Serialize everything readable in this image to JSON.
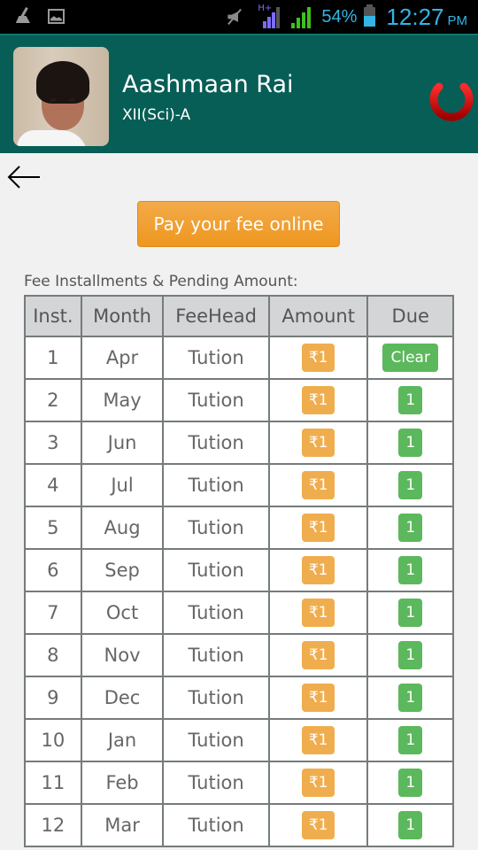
{
  "status_bar": {
    "left_icons": [
      "cleaner-icon",
      "gallery-icon"
    ],
    "right_icons": [
      "mute-icon",
      "signal-hplus-icon",
      "signal-icon",
      "battery-icon"
    ],
    "network_label": "H+",
    "battery_percent": "54%",
    "time": "12:27",
    "ampm": "PM"
  },
  "header": {
    "student_name": "Aashmaan Rai",
    "student_class": "XII(Sci)-A",
    "power_icon": "power-icon"
  },
  "nav": {
    "back_icon": "back-arrow-icon"
  },
  "pay_button": {
    "label": "Pay your fee online"
  },
  "fee_table": {
    "caption": "Fee Installments & Pending Amount:",
    "headers": [
      "Inst.",
      "Month",
      "FeeHead",
      "Amount",
      "Due"
    ],
    "rows": [
      {
        "inst": "1",
        "month": "Apr",
        "feehead": "Tution",
        "amount": "₹1",
        "due": "Clear"
      },
      {
        "inst": "2",
        "month": "May",
        "feehead": "Tution",
        "amount": "₹1",
        "due": "1"
      },
      {
        "inst": "3",
        "month": "Jun",
        "feehead": "Tution",
        "amount": "₹1",
        "due": "1"
      },
      {
        "inst": "4",
        "month": "Jul",
        "feehead": "Tution",
        "amount": "₹1",
        "due": "1"
      },
      {
        "inst": "5",
        "month": "Aug",
        "feehead": "Tution",
        "amount": "₹1",
        "due": "1"
      },
      {
        "inst": "6",
        "month": "Sep",
        "feehead": "Tution",
        "amount": "₹1",
        "due": "1"
      },
      {
        "inst": "7",
        "month": "Oct",
        "feehead": "Tution",
        "amount": "₹1",
        "due": "1"
      },
      {
        "inst": "8",
        "month": "Nov",
        "feehead": "Tution",
        "amount": "₹1",
        "due": "1"
      },
      {
        "inst": "9",
        "month": "Dec",
        "feehead": "Tution",
        "amount": "₹1",
        "due": "1"
      },
      {
        "inst": "10",
        "month": "Jan",
        "feehead": "Tution",
        "amount": "₹1",
        "due": "1"
      },
      {
        "inst": "11",
        "month": "Feb",
        "feehead": "Tution",
        "amount": "₹1",
        "due": "1"
      },
      {
        "inst": "12",
        "month": "Mar",
        "feehead": "Tution",
        "amount": "₹1",
        "due": "1"
      }
    ]
  },
  "colors": {
    "header_bg": "#075e56",
    "pay_button": "#f0a030",
    "amount_badge": "#f0ad4e",
    "due_badge": "#5cb85c",
    "power_icon": "#d40000",
    "status_accent": "#33b5e5"
  }
}
